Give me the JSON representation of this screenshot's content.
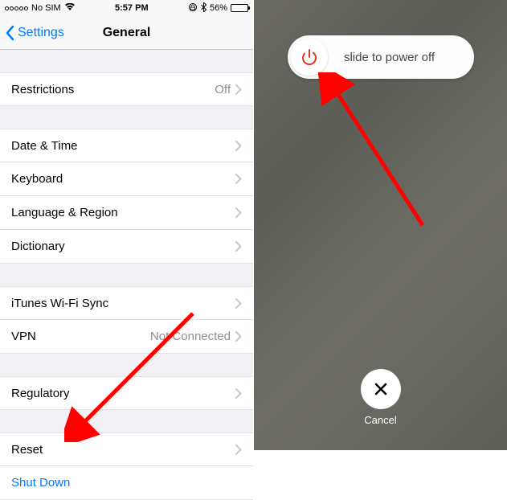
{
  "statusBar": {
    "carrier": "No SIM",
    "time": "5:57 PM",
    "batteryPct": "56%"
  },
  "nav": {
    "back": "Settings",
    "title": "General"
  },
  "cells": {
    "restrictions": {
      "label": "Restrictions",
      "value": "Off"
    },
    "dateTime": {
      "label": "Date & Time"
    },
    "keyboard": {
      "label": "Keyboard"
    },
    "languageRegion": {
      "label": "Language & Region"
    },
    "dictionary": {
      "label": "Dictionary"
    },
    "itunesSync": {
      "label": "iTunes Wi-Fi Sync"
    },
    "vpn": {
      "label": "VPN",
      "value": "Not Connected"
    },
    "regulatory": {
      "label": "Regulatory"
    },
    "reset": {
      "label": "Reset"
    },
    "shutDown": {
      "label": "Shut Down"
    }
  },
  "powerOff": {
    "slideText": "slide to power off",
    "cancel": "Cancel"
  },
  "colors": {
    "iosBlue": "#007aff",
    "powerRed": "#e33628",
    "arrowRed": "#ff0000"
  }
}
